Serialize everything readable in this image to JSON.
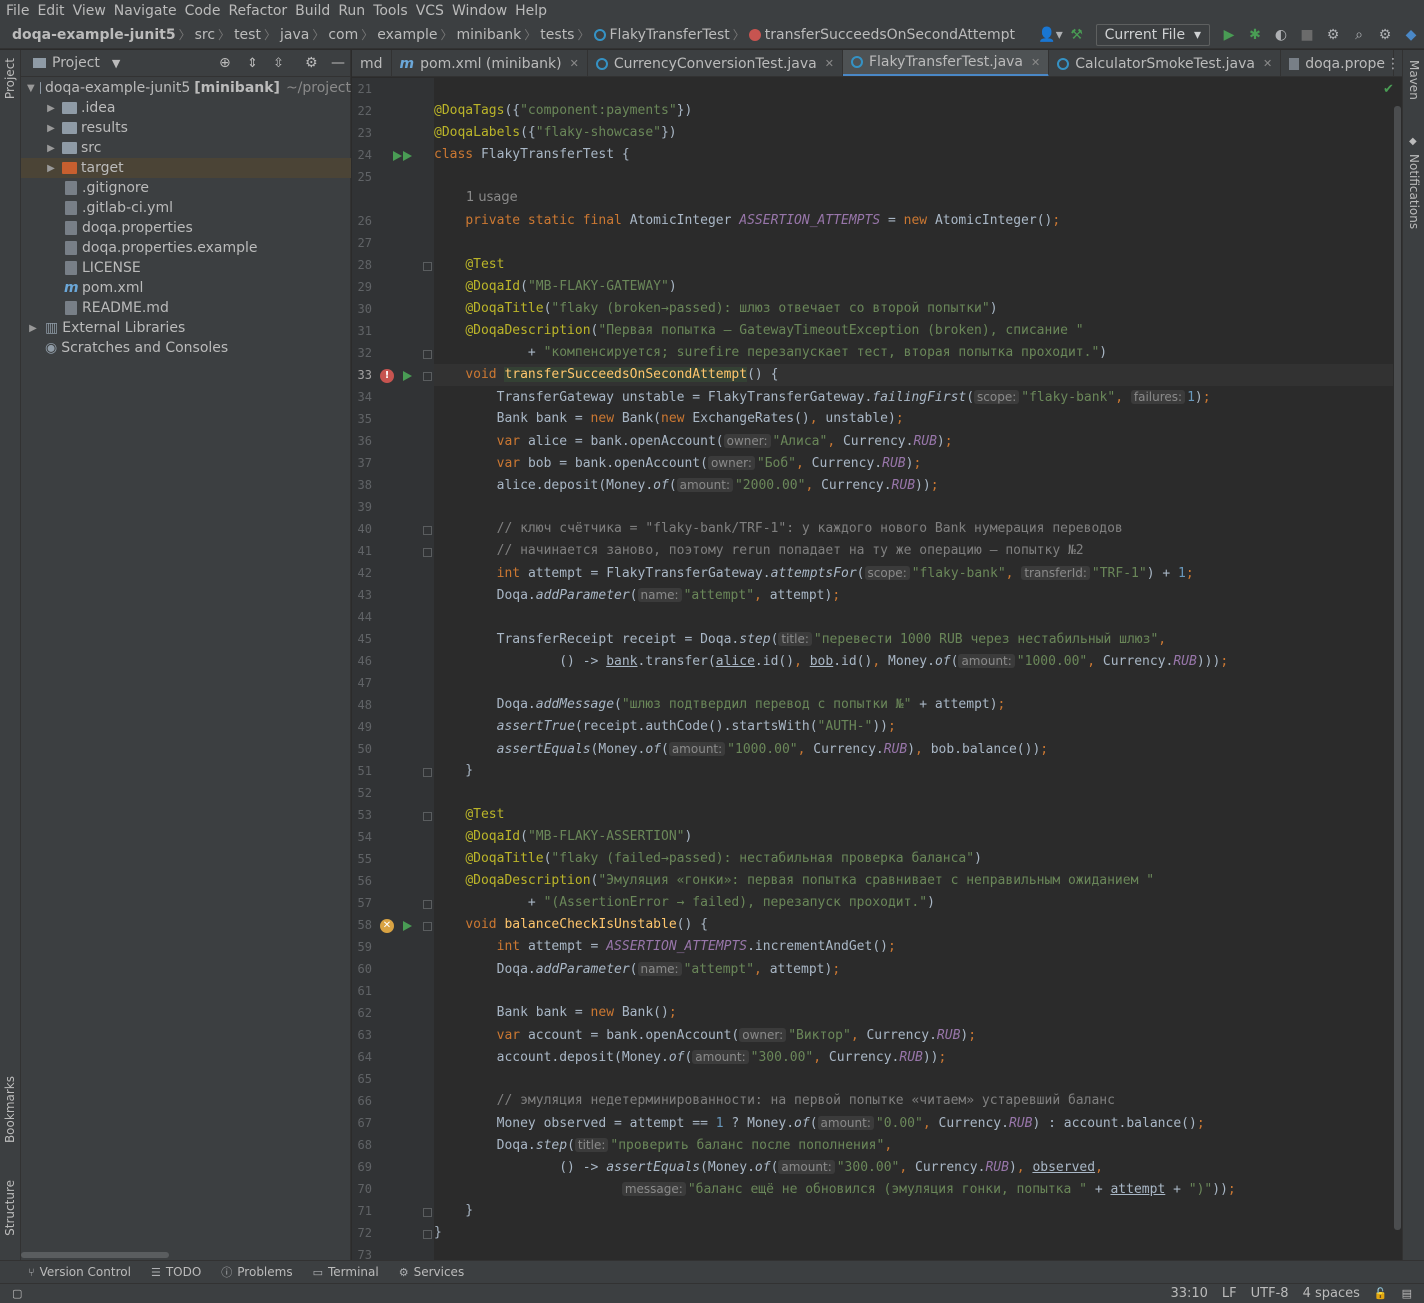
{
  "menu": [
    "File",
    "Edit",
    "View",
    "Navigate",
    "Code",
    "Refactor",
    "Build",
    "Run",
    "Tools",
    "VCS",
    "Window",
    "Help"
  ],
  "breadcrumbs": [
    "doqa-example-junit5",
    "src",
    "test",
    "java",
    "com",
    "example",
    "minibank",
    "tests",
    "FlakyTransferTest",
    "transferSucceedsOnSecondAttempt"
  ],
  "run_config": "Current File",
  "left_tabs": {
    "project": "Project",
    "bookmarks": "Bookmarks",
    "structure": "Structure"
  },
  "right_tabs": {
    "maven": "Maven",
    "notifications": "Notifications"
  },
  "project": {
    "title": "Project",
    "root": "doqa-example-junit5",
    "root_module": "[minibank]",
    "root_path": "~/project",
    "items": [
      ".idea",
      "results",
      "src",
      "target",
      ".gitignore",
      ".gitlab-ci.yml",
      "doqa.properties",
      "doqa.properties.example",
      "LICENSE",
      "pom.xml",
      "README.md",
      "External Libraries",
      "Scratches and Consoles"
    ]
  },
  "tabs": [
    {
      "label": "md",
      "close": ""
    },
    {
      "label": "pom.xml (minibank)",
      "close": "✕"
    },
    {
      "label": "CurrencyConversionTest.java",
      "close": "✕"
    },
    {
      "label": "FlakyTransferTest.java",
      "close": "✕"
    },
    {
      "label": "CalculatorSmokeTest.java",
      "close": "✕"
    },
    {
      "label": "doqa.prope",
      "close": ""
    }
  ],
  "editor": {
    "usage_hint": "1 usage",
    "line_numbers": [
      "21",
      "22",
      "23",
      "24",
      "25",
      "26",
      "27",
      "28",
      "29",
      "30",
      "31",
      "32",
      "33",
      "34",
      "35",
      "36",
      "37",
      "38",
      "39",
      "40",
      "41",
      "42",
      "43",
      "44",
      "45",
      "46",
      "47",
      "48",
      "49",
      "50",
      "51",
      "52",
      "53",
      "54",
      "55",
      "56",
      "57",
      "58",
      "59",
      "60",
      "61",
      "62",
      "63",
      "64",
      "65",
      "66",
      "67",
      "68",
      "69",
      "70",
      "71",
      "72",
      "73"
    ],
    "strings": {
      "tags": "\"component:payments\"",
      "labels": "\"flaky-showcase\"",
      "id1": "\"MB-FLAKY-GATEWAY\"",
      "title1": "\"flaky (broken→passed): шлюз отвечает со второй попытки\"",
      "desc1a": "\"Первая попытка — GatewayTimeoutException (broken), списание \"",
      "desc1b": "\"компенсируется; surefire перезапускает тест, вторая попытка проходит.\"",
      "bank": "\"flaky-bank\"",
      "alice": "\"Алиса\"",
      "bob": "\"Боб\"",
      "amount2000": "\"2000.00\"",
      "cmt1": "// ключ счётчика = \"flaky-bank/TRF-1\": у каждого нового Bank нумерация переводов",
      "cmt2": "// начинается заново, поэтому rerun попадает на ту же операцию — попытку №2",
      "trf": "\"TRF-1\"",
      "attempt": "\"attempt\"",
      "step1": "\"перевести 1000 RUB через нестабильный шлюз\"",
      "amount1000": "\"1000.00\"",
      "msg1": "\"шлюз подтвердил перевод с попытки №\"",
      "auth": "\"AUTH-\"",
      "id2": "\"MB-FLAKY-ASSERTION\"",
      "title2": "\"flaky (failed→passed): нестабильная проверка баланса\"",
      "desc2a": "\"Эмуляция «гонки»: первая попытка сравнивает с неправильным ожиданием \"",
      "desc2b": "\"(AssertionError → failed), перезапуск проходит.\"",
      "viktor": "\"Виктор\"",
      "amount300": "\"300.00\"",
      "cmt3": "// эмуляция недетерминированности: на первой попытке «читаем» устаревший баланс",
      "amount0": "\"0.00\"",
      "step2": "\"проверить баланс после пополнения\"",
      "msg2": "\"баланс ещё не обновился (эмуляция гонки, попытка \"",
      "paren": "\")\""
    }
  },
  "bottom_tools": [
    "Version Control",
    "TODO",
    "Problems",
    "Terminal",
    "Services"
  ],
  "status": {
    "position": "33:10",
    "line_sep": "LF",
    "encoding": "UTF-8",
    "indent": "4 spaces"
  },
  "colors": {
    "keyword": "#cc7832",
    "annotation": "#bbb529",
    "string": "#6a8759",
    "comment": "#808080",
    "number": "#6897bb",
    "field": "#9876aa",
    "method": "#ffc66d",
    "error": "#c75450",
    "run": "#499c54"
  }
}
